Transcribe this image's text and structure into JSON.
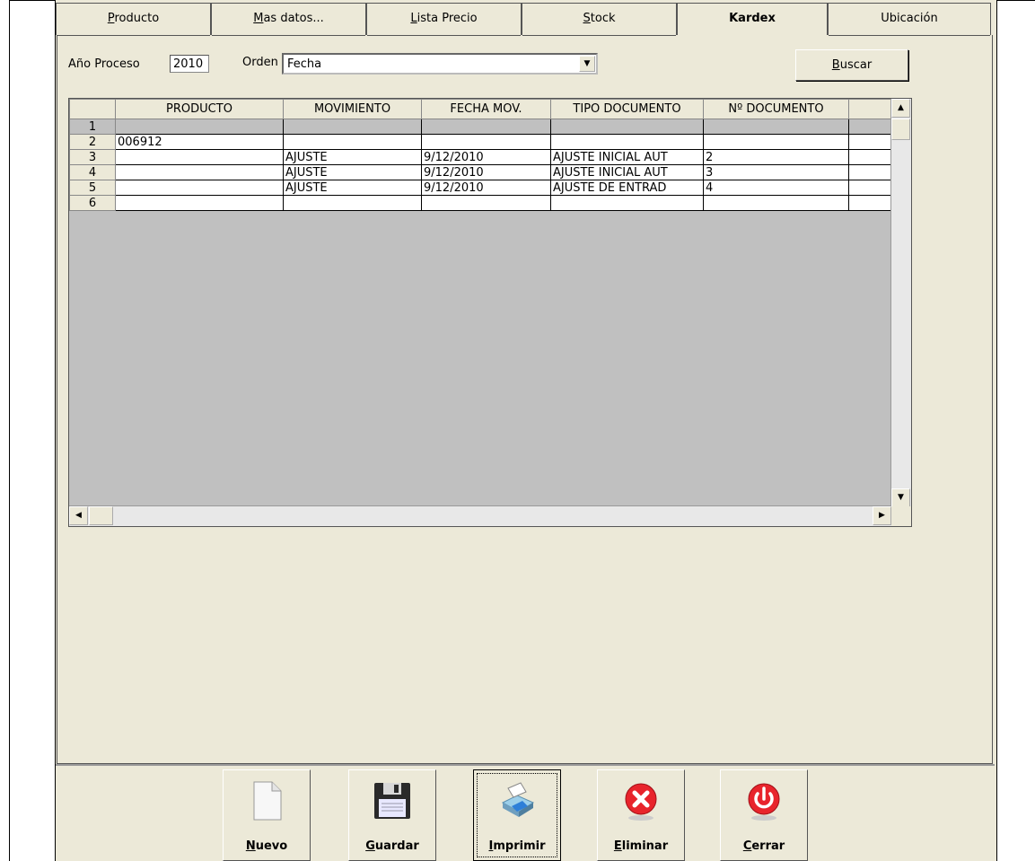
{
  "tabs": [
    {
      "label": "Producto",
      "mnemonic": "P",
      "active": false
    },
    {
      "label": "Mas datos...",
      "mnemonic": "M",
      "active": false
    },
    {
      "label": "Lista Precio",
      "mnemonic": "L",
      "active": false
    },
    {
      "label": "Stock",
      "mnemonic": "S",
      "active": false
    },
    {
      "label": "Kardex",
      "mnemonic": "",
      "active": true
    },
    {
      "label": "Ubicación",
      "mnemonic": "",
      "active": false
    }
  ],
  "filter": {
    "year_label": "Año Proceso",
    "year_value": "2010",
    "order_label": "Orden",
    "order_value": "Fecha",
    "search_label": "Buscar"
  },
  "grid": {
    "columns": [
      "PRODUCTO",
      "MOVIMIENTO",
      "FECHA MOV.",
      "TIPO DOCUMENTO",
      "Nº DOCUMENTO"
    ],
    "rows": [
      {
        "n": "1",
        "producto": "",
        "movimiento": "",
        "fecha": "",
        "tipo": "",
        "numero": ""
      },
      {
        "n": "2",
        "producto": "006912",
        "movimiento": "",
        "fecha": "",
        "tipo": "",
        "numero": ""
      },
      {
        "n": "3",
        "producto": "",
        "movimiento": "AJUSTE",
        "fecha": "9/12/2010",
        "tipo": "AJUSTE INICIAL AUT",
        "numero": "2"
      },
      {
        "n": "4",
        "producto": "",
        "movimiento": "AJUSTE",
        "fecha": "9/12/2010",
        "tipo": "AJUSTE INICIAL AUT",
        "numero": "3"
      },
      {
        "n": "5",
        "producto": "",
        "movimiento": "AJUSTE",
        "fecha": "9/12/2010",
        "tipo": "AJUSTE DE ENTRAD",
        "numero": "4"
      },
      {
        "n": "6",
        "producto": "",
        "movimiento": "",
        "fecha": "",
        "tipo": "",
        "numero": ""
      }
    ]
  },
  "toolbar": {
    "nuevo": "Nuevo",
    "guardar": "Guardar",
    "imprimir": "Imprimir",
    "eliminar": "Eliminar",
    "cerrar": "Cerrar"
  },
  "icons": {
    "nuevo": "new-document-icon",
    "guardar": "floppy-disk-icon",
    "imprimir": "printer-icon",
    "eliminar": "delete-x-icon",
    "cerrar": "power-icon"
  }
}
